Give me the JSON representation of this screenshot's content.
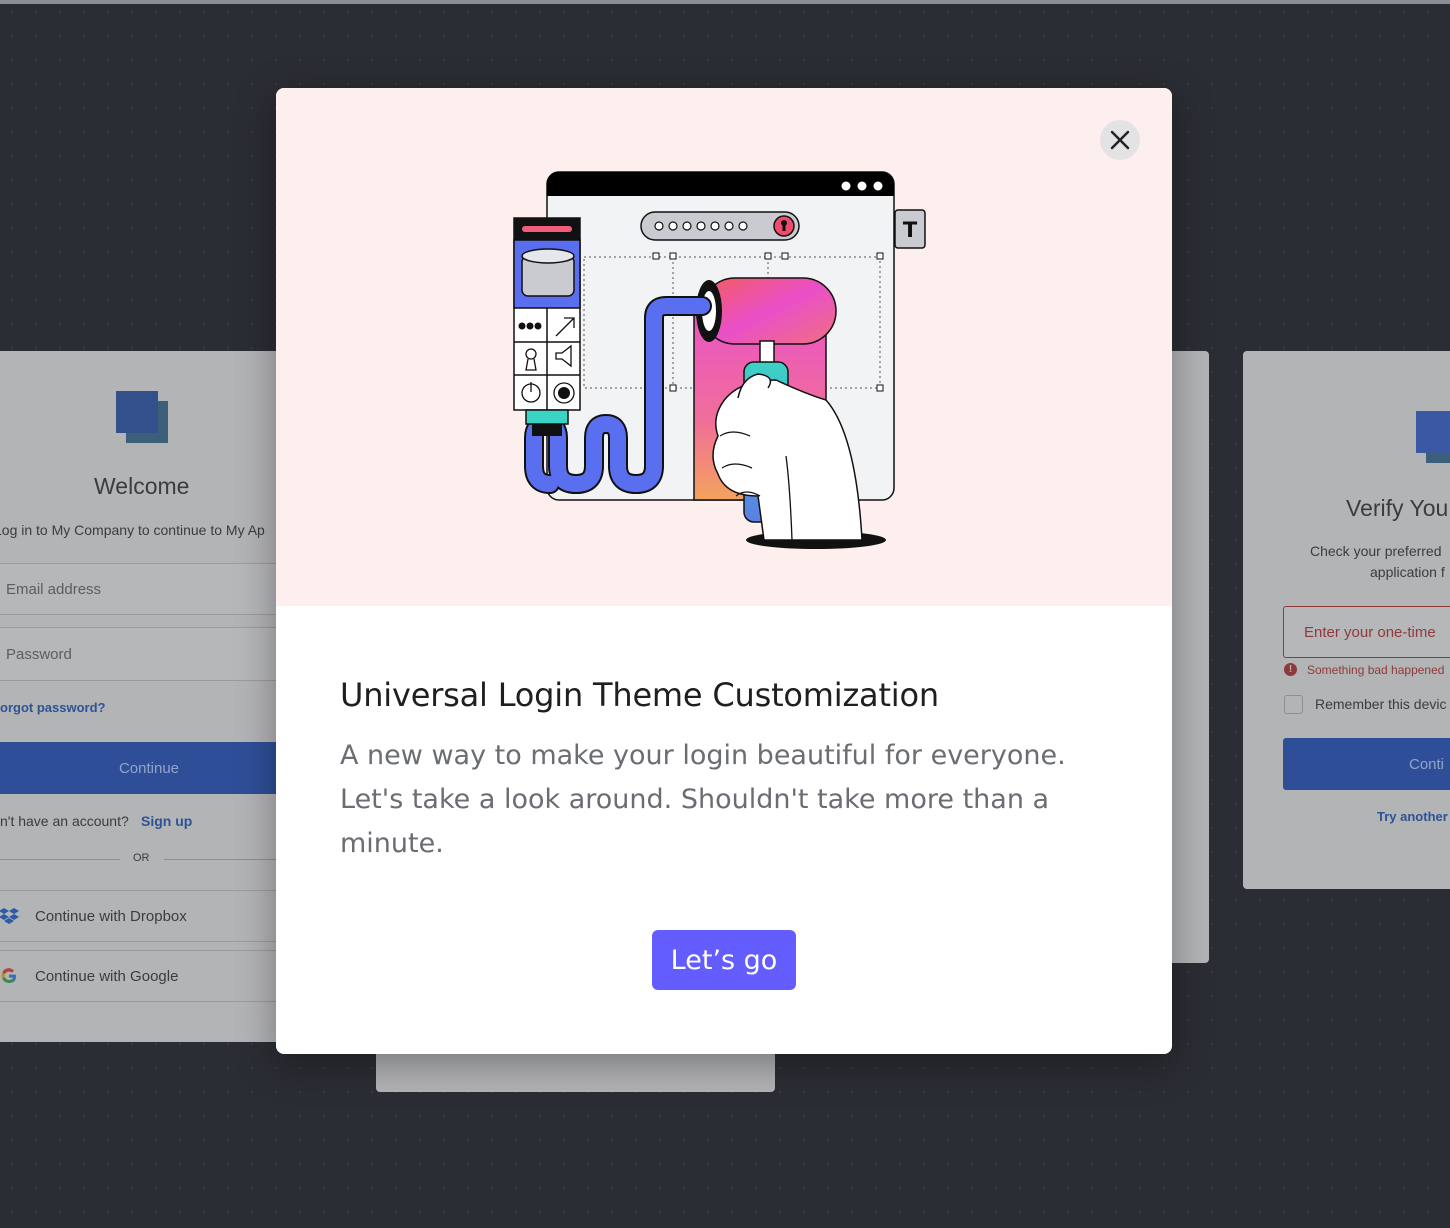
{
  "login_card": {
    "title": "Welcome",
    "subtitle": "Log in to My Company to continue to My Ap",
    "email_placeholder": "Email address",
    "password_placeholder": "Password",
    "forgot_password": "orgot password?",
    "continue_label": "Continue",
    "no_account_text": "n't have an account?",
    "signup_label": "Sign up",
    "or_label": "OR",
    "dropbox_label": "Continue with Dropbox",
    "google_label": "Continue with Google"
  },
  "verify_card": {
    "title": "Verify You",
    "text_line1": "Check your preferred",
    "text_line2": "application f",
    "otp_placeholder": "Enter your one-time",
    "error_text": "Something bad happened",
    "remember_label": "Remember this devic",
    "continue_label": "Conti",
    "try_another": "Try another"
  },
  "modal": {
    "title": "Universal Login Theme Customization",
    "body": "A new way to make your login beautiful for everyone. Let's take a look around. Shouldn't take more than a minute.",
    "cta_label": "Let’s go",
    "close_icon": "close-icon",
    "hero_letter": "T",
    "colors": {
      "accent": "#635dff",
      "hero_background": "#fdefed",
      "backdrop": "#2a2d33"
    }
  }
}
